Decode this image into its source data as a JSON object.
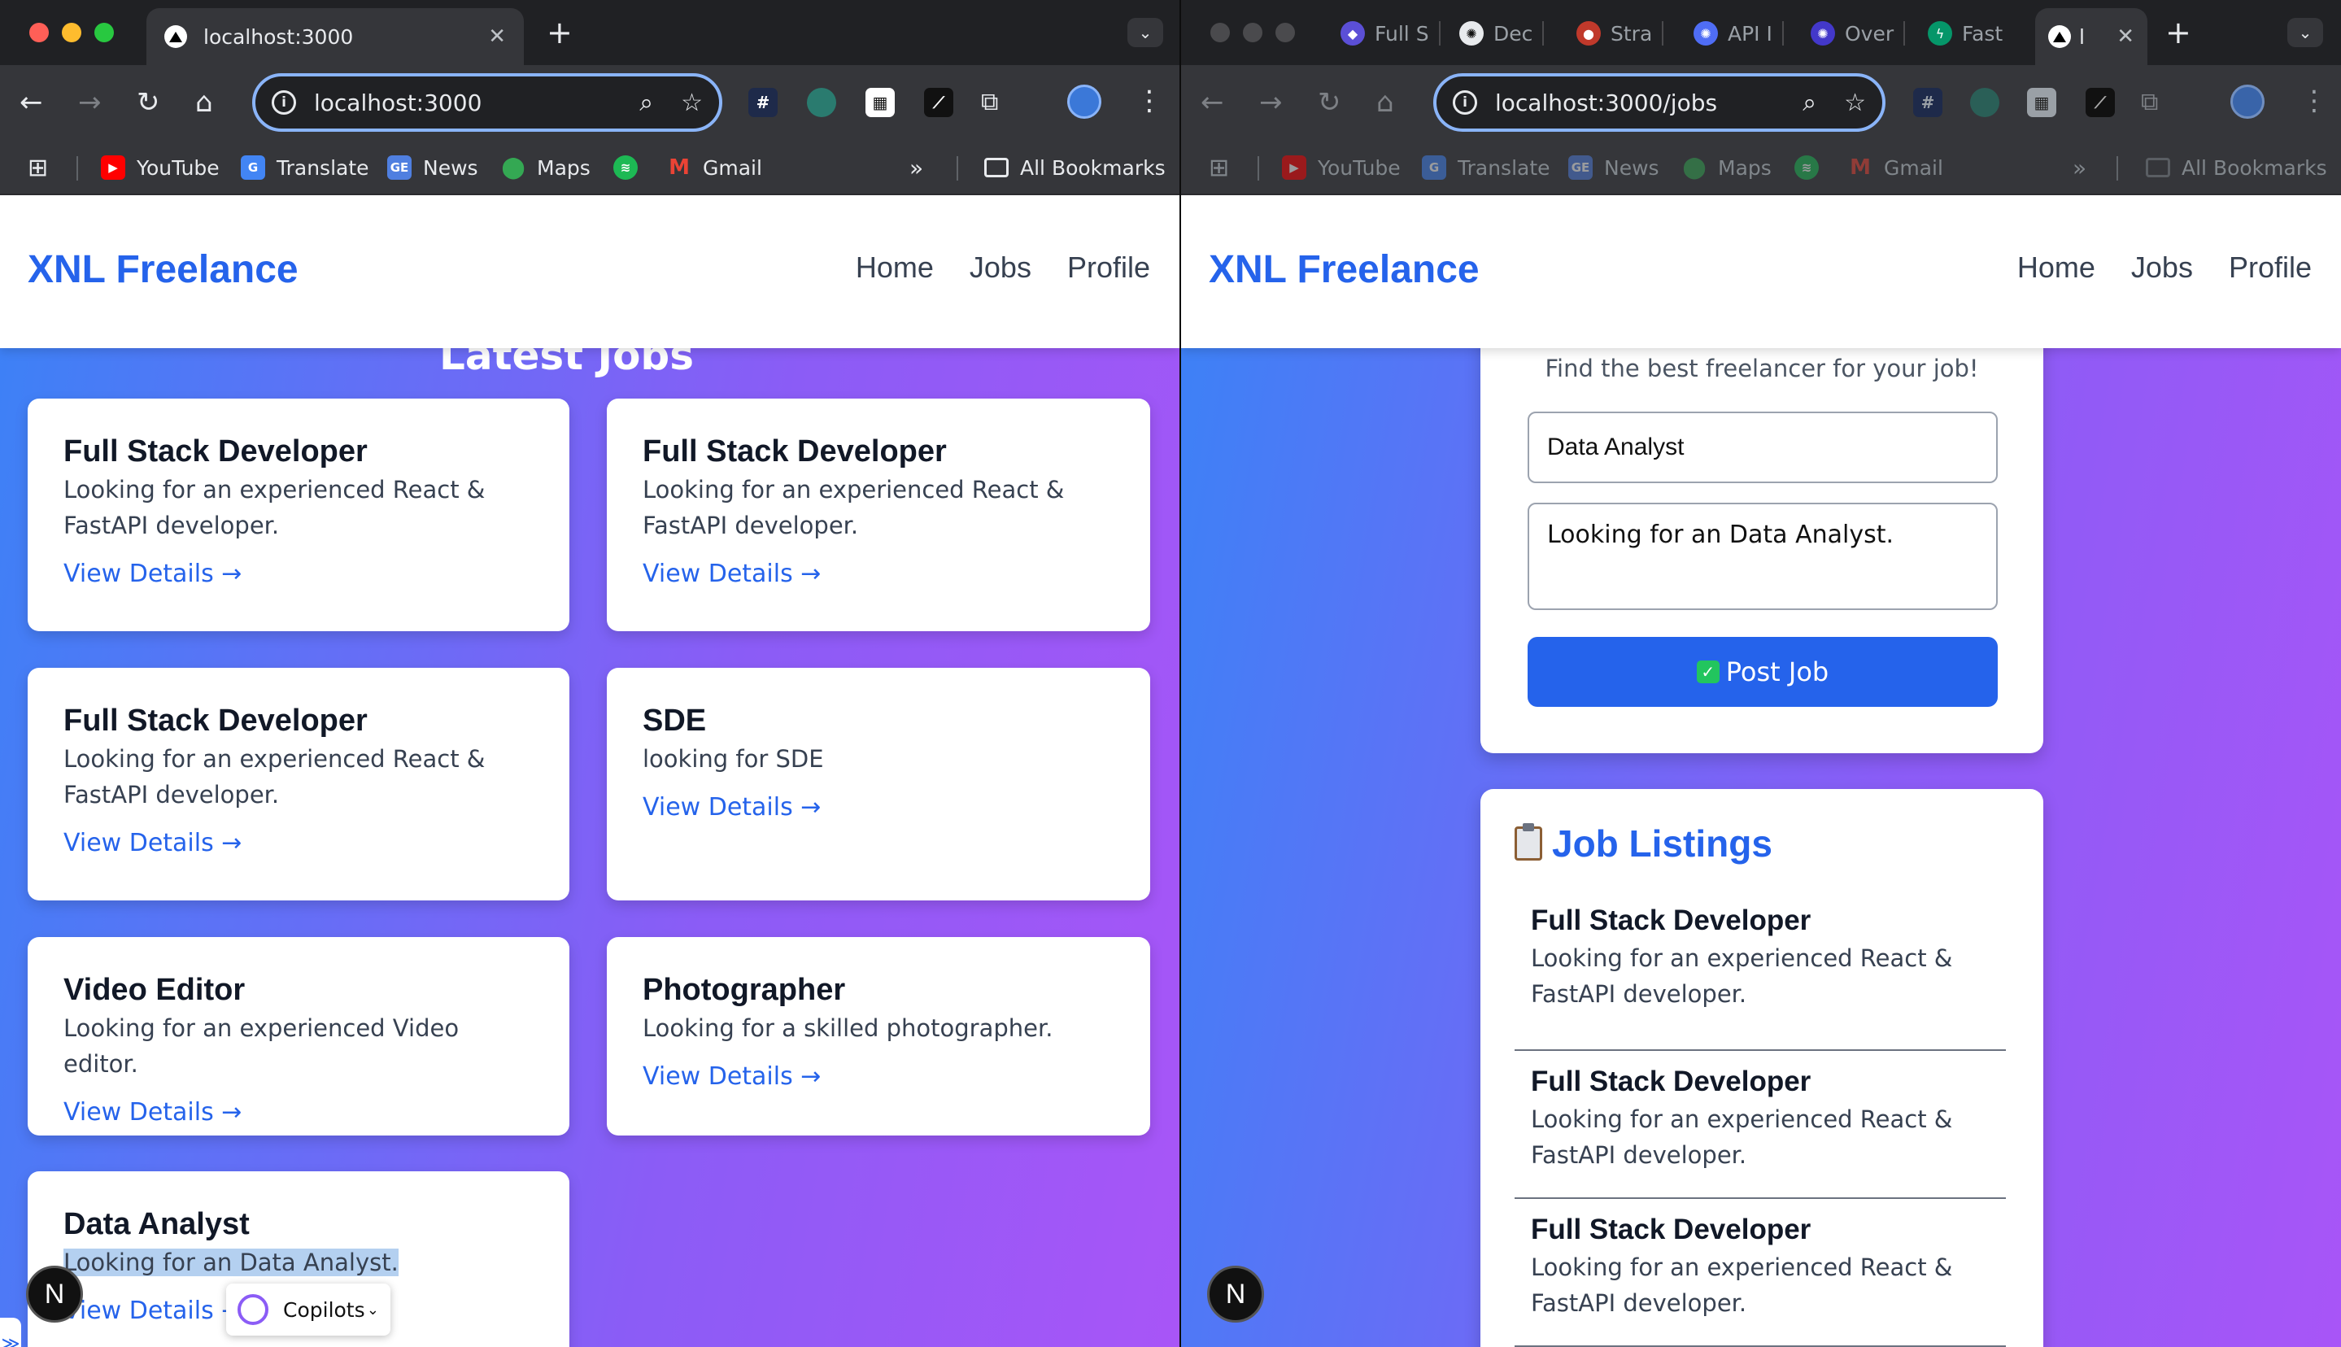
{
  "left": {
    "tabs": {
      "active_title": "localhost:3000"
    },
    "url": "localhost:3000",
    "site": {
      "logo": "XNL Freelance",
      "nav": [
        "Home",
        "Jobs",
        "Profile"
      ],
      "section_peek": "Latest Jobs"
    },
    "cards": [
      {
        "title": "Full Stack Developer",
        "desc": "Looking for an experienced React & FastAPI developer.",
        "link": "View Details →"
      },
      {
        "title": "Full Stack Developer",
        "desc": "Looking for an experienced React & FastAPI developer.",
        "link": "View Details →"
      },
      {
        "title": "Full Stack Developer",
        "desc": "Looking for an experienced React & FastAPI developer.",
        "link": "View Details →"
      },
      {
        "title": "SDE",
        "desc": "looking for SDE",
        "link": "View Details →"
      },
      {
        "title": "Video Editor",
        "desc": "Looking for an experienced Video editor.",
        "link": "View Details →"
      },
      {
        "title": "Photographer",
        "desc": "Looking for a skilled photographer.",
        "link": "View Details →"
      },
      {
        "title": "Data Analyst",
        "desc": "Looking for an Data Analyst.",
        "link": "View Details →"
      }
    ],
    "badge": "N",
    "copilots": "Copilots"
  },
  "right": {
    "tabs": [
      "Full S",
      "Dec",
      "Stra",
      "API I",
      "Over",
      "Fast",
      "l"
    ],
    "url": "localhost:3000/jobs",
    "site": {
      "logo": "XNL Freelance",
      "nav": [
        "Home",
        "Jobs",
        "Profile"
      ]
    },
    "form": {
      "tagline": "Find the best freelancer for your job!",
      "title_value": "Data Analyst",
      "desc_value": "Looking for an Data Analyst.",
      "submit_label": "Post Job"
    },
    "listings": {
      "heading": "Job Listings",
      "items": [
        {
          "title": "Full Stack Developer",
          "desc": "Looking for an experienced React & FastAPI developer."
        },
        {
          "title": "Full Stack Developer",
          "desc": "Looking for an experienced React & FastAPI developer."
        },
        {
          "title": "Full Stack Developer",
          "desc": "Looking for an experienced React & FastAPI developer."
        }
      ]
    },
    "badge": "N"
  },
  "bookmarks": [
    "YouTube",
    "Translate",
    "News",
    "Maps",
    "Gmail",
    "All Bookmarks"
  ],
  "colors": {
    "brand": "#2563eb",
    "gradient_start": "#3b82f6",
    "gradient_end": "#a855f7"
  }
}
